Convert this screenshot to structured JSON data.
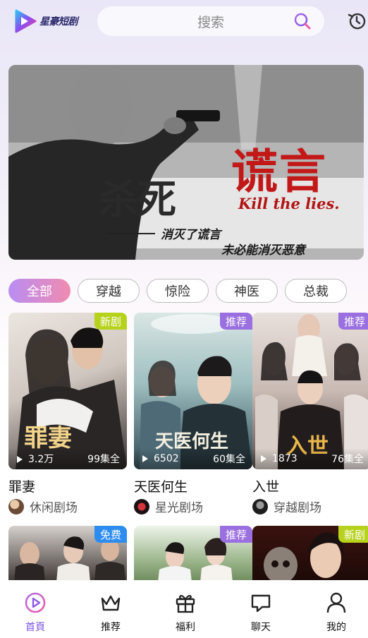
{
  "header": {
    "logo_text": "星豪短剧",
    "search_placeholder": "搜索"
  },
  "banner": {
    "title_part1": "杀死",
    "title_part2": "谎言",
    "english": "Kill the lies.",
    "subtitle1": "消灭了谎言",
    "subtitle2": "未必能消灭恶意"
  },
  "tabs": [
    "全部",
    "穿越",
    "惊险",
    "神医",
    "总裁"
  ],
  "cards": [
    {
      "title": "罪妻",
      "badge": "新剧",
      "badge_type": "new",
      "views": "3.2万",
      "episodes": "99集全",
      "studio": "休闲剧场",
      "poster_text": "罪妻",
      "colors": [
        "#e8e2dc",
        "#3a3030"
      ]
    },
    {
      "title": "天医何生",
      "badge": "推荐",
      "badge_type": "rec",
      "views": "6502",
      "episodes": "60集全",
      "studio": "星光剧场",
      "poster_text": "天医何生",
      "colors": [
        "#c9dcdc",
        "#2e4a52"
      ]
    },
    {
      "title": "入世",
      "badge": "推荐",
      "badge_type": "rec",
      "views": "1873",
      "episodes": "76集全",
      "studio": "穿越剧场",
      "poster_text": "入世",
      "colors": [
        "#d9d2cc",
        "#5b4a46"
      ]
    },
    {
      "badge": "免费",
      "badge_type": "free",
      "colors": [
        "#cfcac6",
        "#3c3532"
      ]
    },
    {
      "badge": "推荐",
      "badge_type": "rec",
      "colors": [
        "#d8e6cf",
        "#6d8a5c"
      ]
    },
    {
      "badge": "新剧",
      "badge_type": "new",
      "colors": [
        "#5a1a14",
        "#1c0a08"
      ]
    }
  ],
  "nav": [
    {
      "label": "首頁",
      "icon": "play-circle-icon",
      "active": true
    },
    {
      "label": "推荐",
      "icon": "crown-icon",
      "active": false
    },
    {
      "label": "福利",
      "icon": "gift-icon",
      "active": false
    },
    {
      "label": "聊天",
      "icon": "chat-icon",
      "active": false
    },
    {
      "label": "我的",
      "icon": "user-icon",
      "active": false
    }
  ],
  "colors": {
    "accent": "#7a52e6",
    "tab_gradient_start": "#b98df2",
    "tab_gradient_end": "#f08bb0"
  }
}
